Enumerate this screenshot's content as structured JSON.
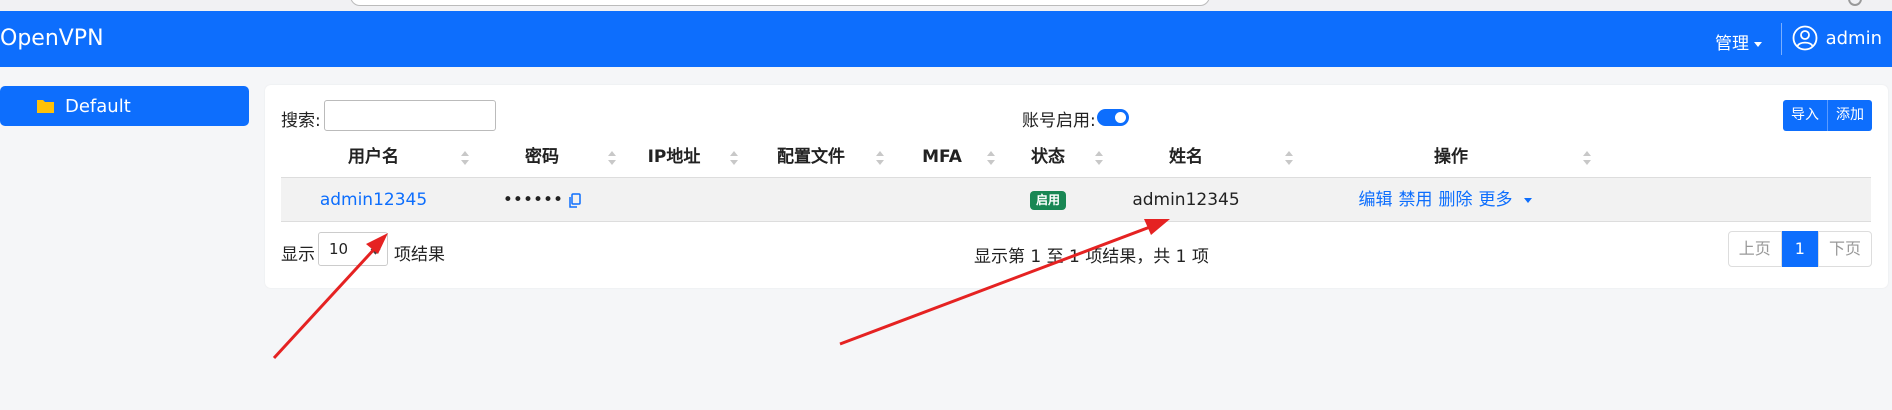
{
  "navbar": {
    "brand": "OpenVPN",
    "manage_label": "管理",
    "user_label": "admin"
  },
  "sidebar": {
    "items": [
      {
        "label": "Default"
      }
    ]
  },
  "toolbar": {
    "search_label": "搜索:",
    "search_value": "",
    "account_toggle_label": "账号启用:",
    "account_toggle_on": true,
    "import_label": "导入",
    "add_label": "添加"
  },
  "table": {
    "columns": [
      "用户名",
      "密码",
      "IP地址",
      "配置文件",
      "MFA",
      "状态",
      "姓名",
      "操作"
    ],
    "rows": [
      {
        "username": "admin12345",
        "password": "••••••",
        "ip": "",
        "config": "",
        "mfa": "",
        "status": "启用",
        "name": "admin12345",
        "actions": [
          "编辑",
          "禁用",
          "删除",
          "更多"
        ]
      }
    ]
  },
  "footer": {
    "show_label": "显示",
    "page_length": "10",
    "page_length_suffix": "项结果",
    "info": "显示第 1 至 1 项结果，共 1 项",
    "prev_label": "上页",
    "current_page": "1",
    "next_label": "下页"
  },
  "colors": {
    "primary": "#0d6efd",
    "status_green": "#198754",
    "arrow_red": "#e52222"
  }
}
